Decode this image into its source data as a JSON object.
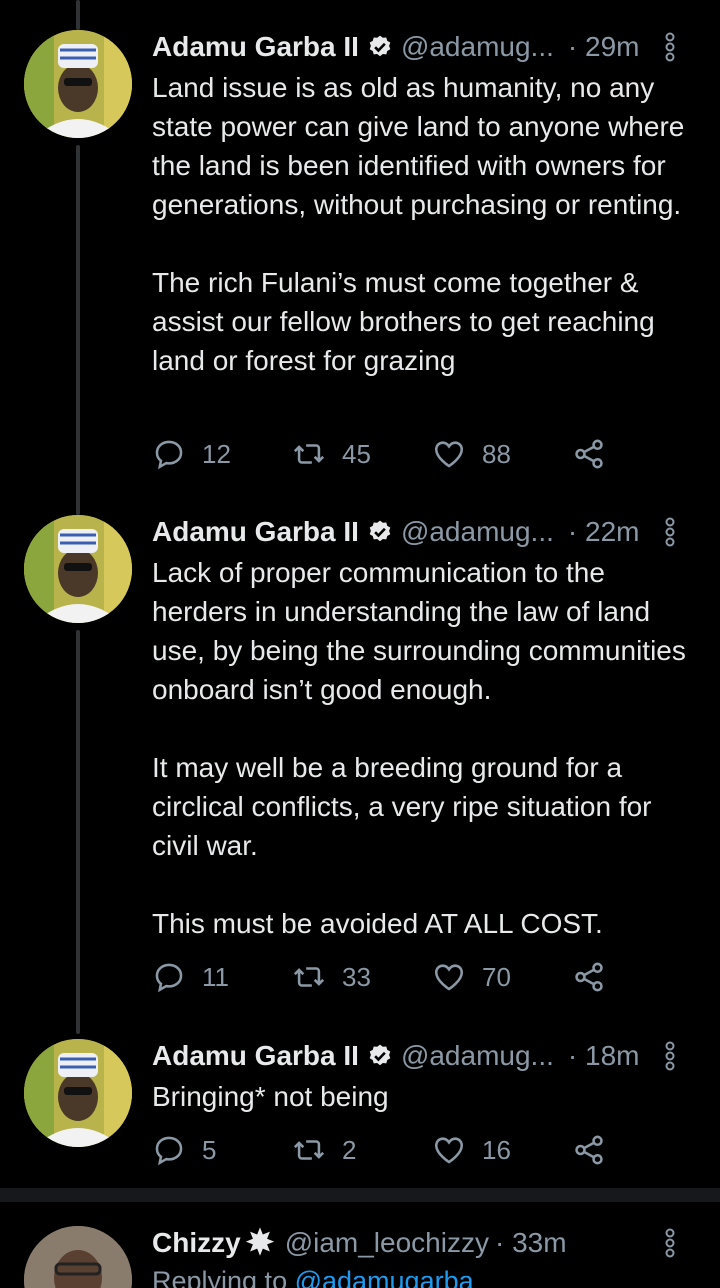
{
  "tweets": [
    {
      "name": "Adamu Garba II",
      "handle": "@adamug...",
      "time": "· 29m",
      "text": "Land issue is as old as humanity, no any state power can give land to anyone where the land is been identified with owners for generations, without purchasing or renting.\n\nThe rich Fulani’s must come together & assist our fellow brothers to get reaching land or forest for grazing",
      "replies": "12",
      "retweets": "45",
      "likes": "88"
    },
    {
      "name": "Adamu Garba II",
      "handle": "@adamug...",
      "time": "· 22m",
      "text": "Lack of proper communication to the herders in understanding the law of land use, by being the surrounding communities onboard isn’t good enough.\n\nIt may well be a breeding ground for a circlical conflicts, a very ripe situation for civil war.\n\nThis must be avoided AT ALL COST.",
      "replies": "11",
      "retweets": "33",
      "likes": "70"
    },
    {
      "name": "Adamu Garba II",
      "handle": "@adamug...",
      "time": "· 18m",
      "text": "Bringing* not being",
      "replies": "5",
      "retweets": "2",
      "likes": "16"
    }
  ],
  "next_tweet": {
    "name": "Chizzy",
    "handle": "@iam_leochizzy",
    "time": "· 33m",
    "replying_prefix": "Replying to ",
    "replying_handle": "@adamugarba"
  },
  "colors": {
    "background": "#000000",
    "text": "#e7e9ea",
    "secondary": "#8b98a5",
    "link": "#1d9bf0",
    "thread_line": "#2f3336"
  }
}
